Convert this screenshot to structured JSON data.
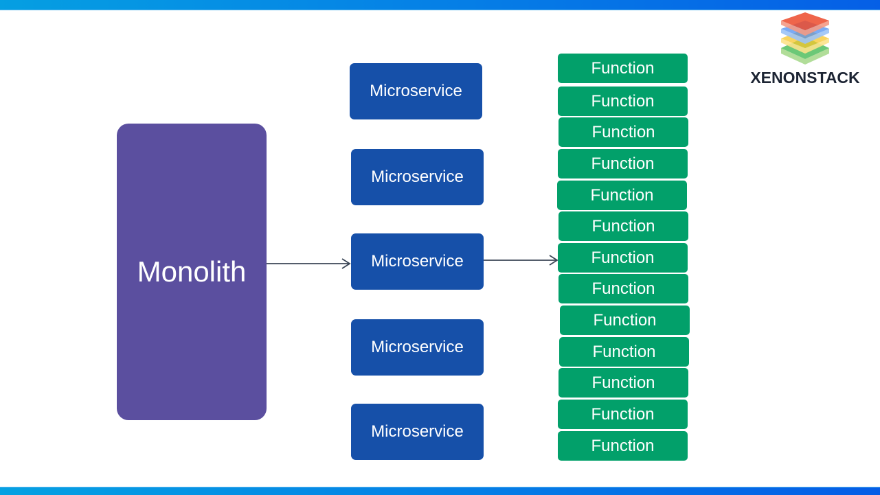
{
  "header": {
    "brand": "XENONSTACK",
    "logo_icon": "layered-stack-logo-icon"
  },
  "colors": {
    "top_bar": "#0580e6",
    "monolith": "#5b4f9f",
    "microservice": "#1650a9",
    "function": "#02a06a",
    "arrow": "#3b4656"
  },
  "diagram": {
    "monolith": {
      "label": "Monolith"
    },
    "microservices": [
      {
        "label": "Microservice"
      },
      {
        "label": "Microservice"
      },
      {
        "label": "Microservice"
      },
      {
        "label": "Microservice"
      },
      {
        "label": "Microservice"
      }
    ],
    "functions": [
      {
        "label": "Function"
      },
      {
        "label": "Function"
      },
      {
        "label": "Function"
      },
      {
        "label": "Function"
      },
      {
        "label": "Function"
      },
      {
        "label": "Function"
      },
      {
        "label": "Function"
      },
      {
        "label": "Function"
      },
      {
        "label": "Function"
      },
      {
        "label": "Function"
      },
      {
        "label": "Function"
      },
      {
        "label": "Function"
      },
      {
        "label": "Function"
      }
    ],
    "edges": [
      {
        "from": "Monolith",
        "to": "Microservice (3)"
      },
      {
        "from": "Microservice (3)",
        "to": "Function (7)"
      }
    ]
  }
}
